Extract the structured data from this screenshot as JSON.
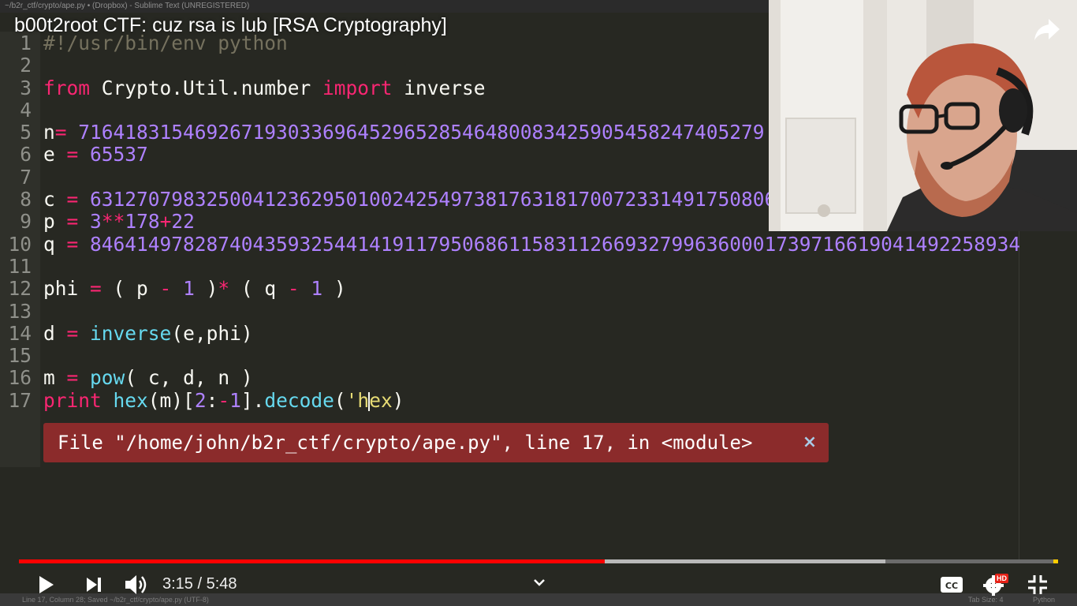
{
  "window": {
    "title": "~/b2r_ctf/crypto/ape.py • (Dropbox) - Sublime Text (UNREGISTERED)"
  },
  "video": {
    "title": "b00t2root CTF: cuz rsa is lub [RSA Cryptography]",
    "time_display": "3:15 / 5:48",
    "progress_fraction": 0.564,
    "buffered_fraction": 0.834,
    "hd_badge": "HD",
    "accent_color": "#ff0000"
  },
  "editor": {
    "lines": [
      {
        "n": "1",
        "tokens": [
          [
            "cm",
            "#!/usr/bin/env python"
          ]
        ]
      },
      {
        "n": "2",
        "tokens": []
      },
      {
        "n": "3",
        "tokens": [
          [
            "kw",
            "from"
          ],
          [
            "txt",
            " Crypto.Util.number "
          ],
          [
            "kw",
            "import"
          ],
          [
            "txt",
            " inverse"
          ]
        ]
      },
      {
        "n": "4",
        "tokens": []
      },
      {
        "n": "5",
        "tokens": [
          [
            "txt",
            "n"
          ],
          [
            "op",
            "="
          ],
          [
            "txt",
            " "
          ],
          [
            "num",
            "71641831546926719303369645296528546480083425905458247405279"
          ]
        ]
      },
      {
        "n": "6",
        "tokens": [
          [
            "txt",
            "e "
          ],
          [
            "op",
            "="
          ],
          [
            "txt",
            " "
          ],
          [
            "num",
            "65537"
          ]
        ]
      },
      {
        "n": "7",
        "tokens": []
      },
      {
        "n": "8",
        "tokens": [
          [
            "txt",
            "c "
          ],
          [
            "op",
            "="
          ],
          [
            "txt",
            " "
          ],
          [
            "num",
            "63127079832500412362950100242549738176318170072331491750806"
          ]
        ]
      },
      {
        "n": "9",
        "tokens": [
          [
            "txt",
            "p "
          ],
          [
            "op",
            "="
          ],
          [
            "txt",
            " "
          ],
          [
            "num",
            "3"
          ],
          [
            "op",
            "**"
          ],
          [
            "num",
            "178"
          ],
          [
            "op",
            "+"
          ],
          [
            "num",
            "22"
          ]
        ]
      },
      {
        "n": "10",
        "tokens": [
          [
            "txt",
            "q "
          ],
          [
            "op",
            "="
          ],
          [
            "txt",
            " "
          ],
          [
            "num",
            "84641497828740435932544141911795068611583112669327996360001739716619041492258934"
          ]
        ]
      },
      {
        "n": "11",
        "tokens": []
      },
      {
        "n": "12",
        "tokens": [
          [
            "txt",
            "phi "
          ],
          [
            "op",
            "="
          ],
          [
            "txt",
            " ( p "
          ],
          [
            "op",
            "-"
          ],
          [
            "txt",
            " "
          ],
          [
            "num",
            "1"
          ],
          [
            "txt",
            " )"
          ],
          [
            "op",
            "*"
          ],
          [
            "txt",
            " ( q "
          ],
          [
            "op",
            "-"
          ],
          [
            "txt",
            " "
          ],
          [
            "num",
            "1"
          ],
          [
            "txt",
            " )"
          ]
        ]
      },
      {
        "n": "13",
        "tokens": []
      },
      {
        "n": "14",
        "tokens": [
          [
            "txt",
            "d "
          ],
          [
            "op",
            "="
          ],
          [
            "txt",
            " "
          ],
          [
            "fn",
            "inverse"
          ],
          [
            "txt",
            "(e,phi)"
          ]
        ]
      },
      {
        "n": "15",
        "tokens": []
      },
      {
        "n": "16",
        "tokens": [
          [
            "txt",
            "m "
          ],
          [
            "op",
            "="
          ],
          [
            "txt",
            " "
          ],
          [
            "fn",
            "pow"
          ],
          [
            "txt",
            "( c, d, n )"
          ]
        ]
      },
      {
        "n": "17",
        "tokens": [
          [
            "kw",
            "print"
          ],
          [
            "txt",
            " "
          ],
          [
            "fn",
            "hex"
          ],
          [
            "txt",
            "(m)["
          ],
          [
            "num",
            "2"
          ],
          [
            "txt",
            ":"
          ],
          [
            "op",
            "-"
          ],
          [
            "num",
            "1"
          ],
          [
            "txt",
            "]."
          ],
          [
            "fn",
            "decode"
          ],
          [
            "txt",
            "("
          ],
          [
            "str",
            "'h"
          ],
          [
            "cursor",
            ""
          ],
          [
            "str",
            "ex"
          ],
          [
            "txt",
            ")"
          ]
        ]
      }
    ],
    "error_message": "File \"/home/john/b2r_ctf/crypto/ape.py\", line 17, in <module>",
    "error_close": "×"
  },
  "status_bar": {
    "left": "Line 17, Column 28; Saved ~/b2r_ctf/crypto/ape.py (UTF-8)",
    "tab_size": "Tab Size: 4",
    "syntax": "Python"
  },
  "icons": {
    "play": "play-icon",
    "next": "next-icon",
    "volume": "volume-icon",
    "captions": "captions-icon",
    "settings": "settings-icon",
    "exit_fullscreen": "exit-fullscreen-icon",
    "share": "share-icon",
    "chevron": "chevron-down-icon"
  }
}
